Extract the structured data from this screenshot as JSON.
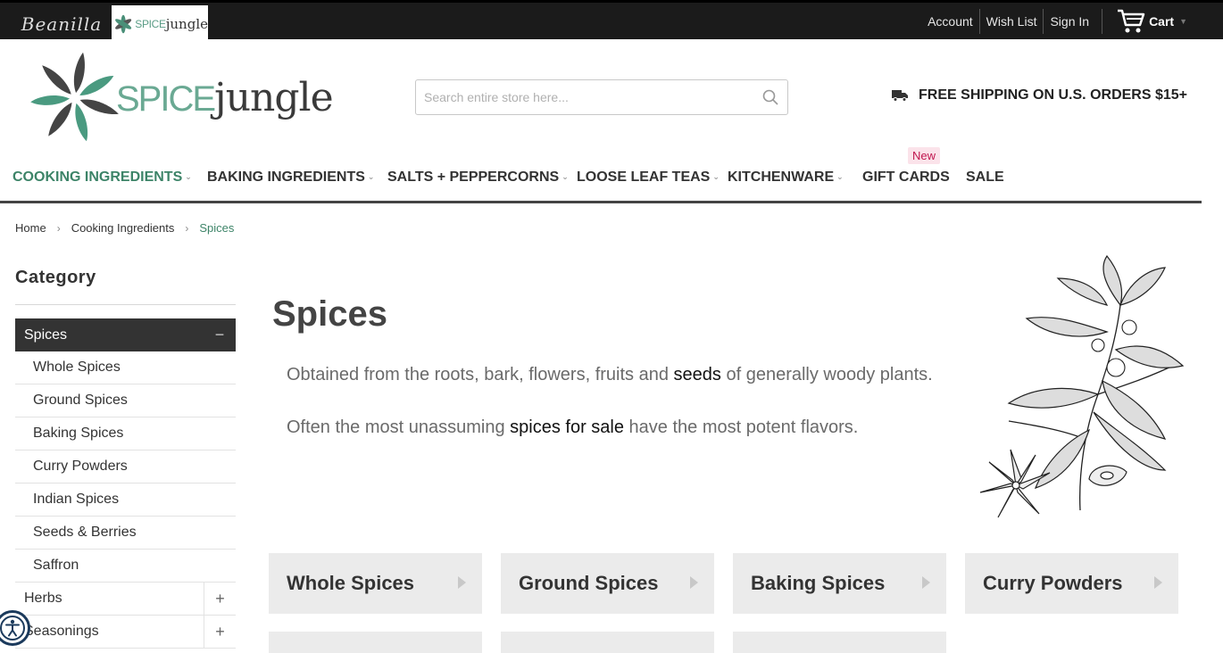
{
  "topbar": {
    "brand_beanilla": "Beanilla",
    "brand_sj_light": "SPICE",
    "brand_sj_dark": "jungle",
    "links": [
      "Account",
      "Wish List",
      "Sign In"
    ],
    "cart_label": "Cart"
  },
  "header": {
    "logo_light": "SPICE",
    "logo_dark": "jungle",
    "search_placeholder": "Search entire store here...",
    "shipping_text": "FREE SHIPPING ON U.S. ORDERS $15+"
  },
  "nav": {
    "items": [
      "COOKING INGREDIENTS",
      "BAKING INGREDIENTS",
      "SALTS + PEPPERCORNS",
      "LOOSE LEAF TEAS",
      "KITCHENWARE",
      "GIFT CARDS",
      "SALE"
    ],
    "new_badge": "New"
  },
  "breadcrumb": [
    "Home",
    "Cooking Ingredients",
    "Spices"
  ],
  "sidebar": {
    "title": "Category",
    "items": [
      {
        "label": "Spices",
        "toggle": "−"
      },
      {
        "label": "Whole Spices"
      },
      {
        "label": "Ground Spices"
      },
      {
        "label": "Baking Spices"
      },
      {
        "label": "Curry Powders"
      },
      {
        "label": "Indian Spices"
      },
      {
        "label": "Seeds & Berries"
      },
      {
        "label": "Saffron"
      },
      {
        "label": "Herbs",
        "toggle": "+"
      },
      {
        "label": "Seasonings",
        "toggle": "+"
      }
    ]
  },
  "main": {
    "title": "Spices",
    "para1_a": "Obtained from the roots, bark, flowers, fruits and ",
    "para1_link": "seeds",
    "para1_b": " of generally woody plants.",
    "para2_a": "Often the most unassuming ",
    "para2_link": "spices for sale",
    "para2_b": " have the most potent flavors.",
    "tiles": [
      "Whole Spices",
      "Ground Spices",
      "Baking Spices",
      "Curry Powders"
    ]
  },
  "colors": {
    "accent_green": "#3d8468",
    "topbar_bg": "#1b1b1b",
    "new_badge": "#c0164e"
  }
}
